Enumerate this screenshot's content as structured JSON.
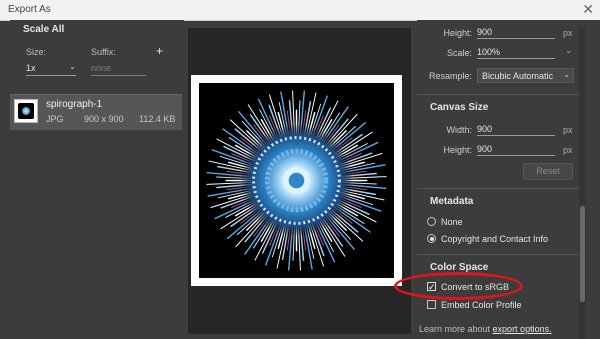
{
  "window": {
    "title": "Export As",
    "close_glyph": "✕"
  },
  "left": {
    "section_title": "Scale All",
    "size_label": "Size:",
    "suffix_label": "Suffix:",
    "add_glyph": "+",
    "scale_value": "1x",
    "suffix_placeholder": "none",
    "file": {
      "name": "spirograph-1",
      "type": "JPG",
      "dimensions": "900 x 900",
      "size": "112.4 KB"
    }
  },
  "right": {
    "height_label": "Height:",
    "height_value": "900",
    "height_unit": "px",
    "scale_label": "Scale:",
    "scale_value": "100%",
    "resample_label": "Resample:",
    "resample_value": "Bicubic Automatic",
    "canvas_size": {
      "title": "Canvas Size",
      "width_label": "Width:",
      "width_value": "900",
      "width_unit": "px",
      "height_label": "Height:",
      "height_value": "900",
      "height_unit": "px",
      "reset_label": "Reset"
    },
    "metadata": {
      "title": "Metadata",
      "option_none": "None",
      "option_copyright": "Copyright and Contact Info",
      "selected": "Copyright and Contact Info"
    },
    "color_space": {
      "title": "Color Space",
      "convert_label": "Convert to sRGB",
      "convert_checked": true,
      "embed_label": "Embed Color Profile",
      "embed_checked": false
    },
    "learn_more_prefix": "Learn more about ",
    "learn_more_link": "export options."
  },
  "colors": {
    "annotation": "#e0141e"
  }
}
